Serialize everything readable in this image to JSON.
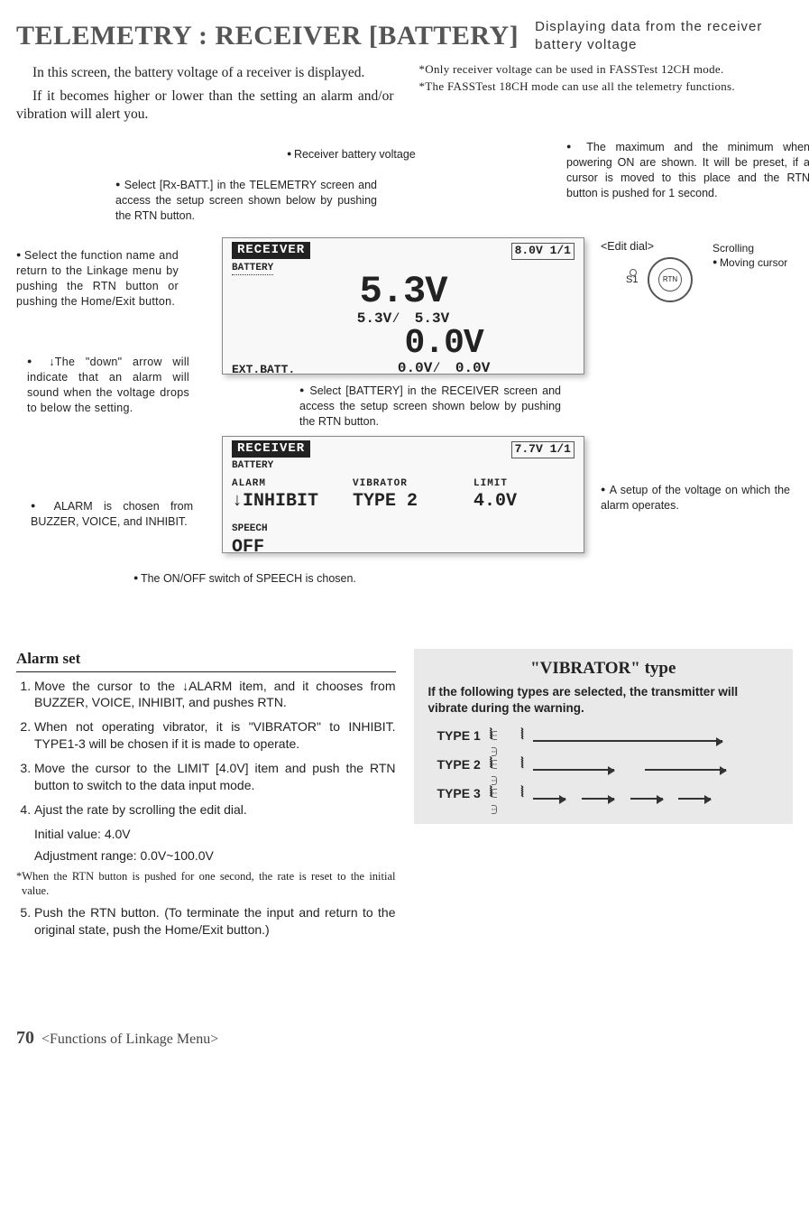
{
  "header": {
    "title": "TELEMETRY : RECEIVER [BATTERY]",
    "subtitle": "Displaying data from the receiver battery voltage"
  },
  "intro": {
    "p1": "In this screen, the battery voltage of a receiver is displayed.",
    "p2": "If it becomes higher or lower than the setting  an alarm and/or vibration will alert you.",
    "note1": "*Only receiver voltage can be used in FASSTest 12CH mode.",
    "note2": "*The FASSTest 18CH mode can use all the telemetry functions."
  },
  "callouts": {
    "select_rxbatt": "Select [Rx-BATT.] in the TELEMETRY screen and access the setup screen shown below by pushing the RTN button.",
    "rx_voltage": "Receiver battery voltage",
    "minmax": "The maximum and the minimum when powering ON are shown. It will be preset, if a cursor is moved to this place and the RTN button is pushed for 1 second.",
    "select_fn": "Select the function name and return to the Linkage menu by pushing the RTN button or pushing the Home/Exit button.",
    "down_arrow": "↓The \"down\" arrow will indicate that an alarm will sound when the voltage drops to below the setting.",
    "select_battery": "Select [BATTERY] in the RECEIVER screen and access the setup screen shown below by pushing the RTN button.",
    "alarm_chosen": "ALARM is chosen from BUZZER, VOICE, and INHIBIT.",
    "speech_switch": "The ON/OFF switch of SPEECH is chosen.",
    "limit_setup": "A setup of the voltage on which the alarm operates.",
    "edit_dial": "<Edit dial>",
    "scrolling": "Scrolling",
    "moving_cursor": "Moving cursor",
    "s1": "S1",
    "rtn": "RTN"
  },
  "lcd_top": {
    "header": "RECEIVER",
    "corner": "8.0V 1/1",
    "battery_label": "BATTERY",
    "main_v": "5.3V",
    "sub_v": "5.3V∕　5.3V",
    "ext_label": "EXT.BATT.",
    "ext_v": "0.0V",
    "ext_sub": "0.0V∕　0.0V"
  },
  "lcd_bot": {
    "header": "RECEIVER",
    "corner": "7.7V 1/1",
    "battery_label": "BATTERY",
    "alarm_lbl": "ALARM",
    "alarm_val": "↓INHIBIT",
    "vib_lbl": "VIBRATOR",
    "vib_val": "TYPE 2",
    "limit_lbl": "LIMIT",
    "limit_val": "4.0V",
    "speech_lbl": "SPEECH",
    "speech_val": "OFF"
  },
  "alarm": {
    "heading": "Alarm set",
    "s1": "Move the cursor to the ↓ALARM  item, and it chooses from BUZZER, VOICE, INHIBIT, and pushes RTN.",
    "s2": "When not operating vibrator, it is \"VIBRATOR\" to INHIBIT. TYPE1-3 will be chosen if it is made to operate.",
    "s3": "Move the cursor to the LIMIT [4.0V] item and push the RTN button to switch to the data input mode.",
    "s4": "Ajust the rate by scrolling the edit dial.",
    "s4a": "Initial value: 4.0V",
    "s4b": "Adjustment range: 0.0V~100.0V",
    "s4note": "*When the RTN button is pushed for one second, the rate is reset to the initial value.",
    "s5": "Push the RTN button. (To terminate the input and return to the original state, push the Home/Exit button.)"
  },
  "vibrator": {
    "title": "\"VIBRATOR\" type",
    "sub": "If the following types are selected, the transmitter will vibrate during the warning.",
    "t1": "TYPE 1",
    "t2": "TYPE 2",
    "t3": "TYPE 3"
  },
  "footer": {
    "page": "70",
    "label": "<Functions of Linkage Menu>"
  }
}
